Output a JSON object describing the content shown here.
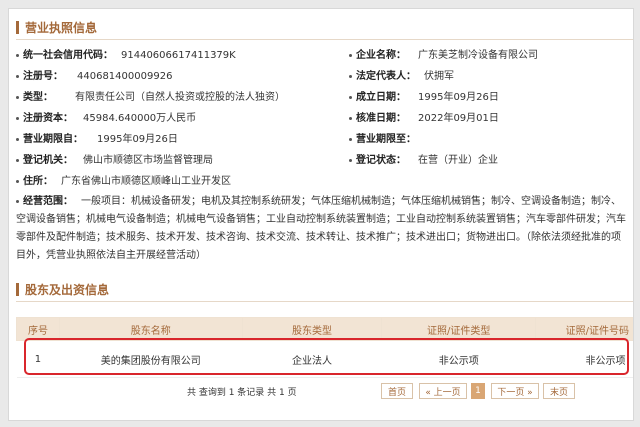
{
  "section1": {
    "title": "营业执照信息"
  },
  "fields_left": [
    {
      "label": "统一社会信用代码：",
      "value": "91440606617411379K"
    },
    {
      "label": "注册号：",
      "value": "440681400009926"
    },
    {
      "label": "类型：",
      "value": "有限责任公司（自然人投资或控股的法人独资）"
    },
    {
      "label": "注册资本：",
      "value": "45984.640000万人民币"
    },
    {
      "label": "营业期限自：",
      "value": "1995年09月26日"
    },
    {
      "label": "登记机关：",
      "value": "佛山市顺德区市场监督管理局"
    },
    {
      "label": "住所：",
      "value": "广东省佛山市顺德区顺峰山工业开发区"
    }
  ],
  "fields_right": [
    {
      "label": "企业名称：",
      "value": "广东美芝制冷设备有限公司"
    },
    {
      "label": "法定代表人：",
      "value": "伏拥军"
    },
    {
      "label": "成立日期：",
      "value": "1995年09月26日"
    },
    {
      "label": "核准日期：",
      "value": "2022年09月01日"
    },
    {
      "label": "营业期限至：",
      "value": ""
    },
    {
      "label": "登记状态：",
      "value": "在营（开业）企业"
    }
  ],
  "scope": {
    "label": "经营范围：",
    "text": "一般项目：机械设备研发；电机及其控制系统研发；气体压缩机械制造；气体压缩机械销售；制冷、空调设备制造；制冷、空调设备销售；机械电气设备制造；机械电气设备销售；工业自动控制系统装置制造；工业自动控制系统装置销售；汽车零部件研发；汽车零部件及配件制造；技术服务、技术开发、技术咨询、技术交流、技术转让、技术推广；技术进出口；货物进出口。（除依法须经批准的项目外，凭营业执照依法自主开展经营活动）"
  },
  "section2": {
    "title": "股东及出资信息"
  },
  "shareholders": {
    "headers": [
      "序号",
      "股东名称",
      "股东类型",
      "证照/证件类型",
      "证照/证件号码"
    ],
    "rows": [
      [
        "1",
        "美的集团股份有限公司",
        "企业法人",
        "非公示项",
        "非公示项"
      ]
    ]
  },
  "pagination": {
    "info": "共 查询到 1 条记录 共 1 页",
    "first": "首页",
    "prev": "« 上一页",
    "current": "1",
    "next": "下一页 »",
    "last": "末页"
  },
  "colors": {
    "accent": "#a4693a",
    "highlight": "#d9262c",
    "header_bg": "#f2e4d4"
  }
}
